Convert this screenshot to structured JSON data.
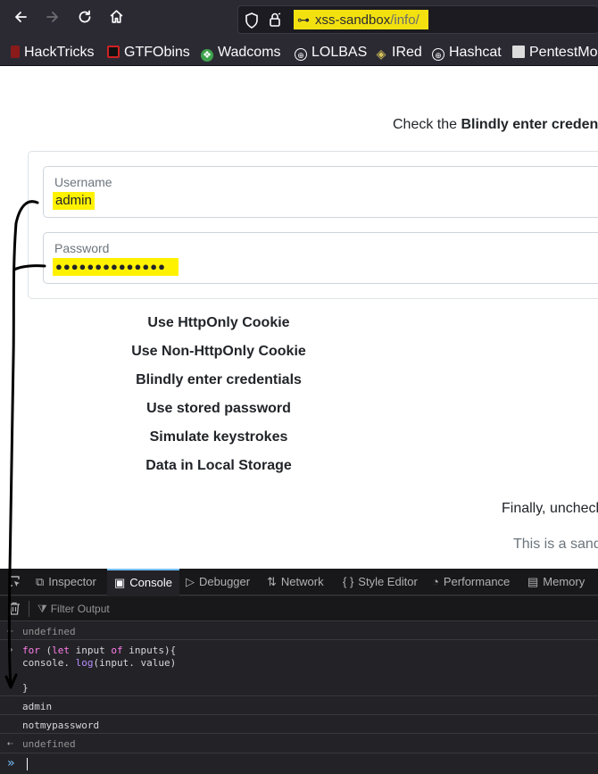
{
  "browser": {
    "url_host": "xss-sandbox",
    "url_path": "/info/",
    "bookmarks": [
      "HackTricks",
      "GTFObins",
      "Wadcoms",
      "LOLBAS",
      "IRed",
      "Hashcat",
      "PentestMo"
    ]
  },
  "page": {
    "instruction_prefix": "Check the ",
    "instruction_bold": "Blindly enter credenti",
    "username_label": "Username",
    "username_value": "admin",
    "password_label": "Password",
    "password_value": "●●●●●●●●●●●●●●",
    "options": [
      "Use HttpOnly Cookie",
      "Use Non-HttpOnly Cookie",
      "Blindly enter credentials",
      "Use stored password",
      "Simulate keystrokes",
      "Data in Local Storage"
    ],
    "finally_text": "Finally, unchecl",
    "sandbox_note": "This is a sand"
  },
  "devtools": {
    "tabs": [
      "Inspector",
      "Console",
      "Debugger",
      "Network",
      "Style Editor",
      "Performance",
      "Memory"
    ],
    "active_tab": "Console",
    "filter_placeholder": "Filter Output",
    "console": {
      "result_1": "undefined",
      "code_kw_1": "for",
      "code_1a": " (",
      "code_kw_2": "let",
      "code_1b": " input ",
      "code_kw_3": "of",
      "code_1c": " inputs){",
      "code_2a": "console. ",
      "code_fn": "log",
      "code_2b": "(input. value)",
      "code_3": "}",
      "log_1": "admin",
      "log_2": "notmypassword",
      "result_2": "undefined"
    }
  },
  "colors": {
    "highlight": "#fff200",
    "url_highlight": "#f2e10f",
    "devtools_accent": "#75bfff"
  }
}
